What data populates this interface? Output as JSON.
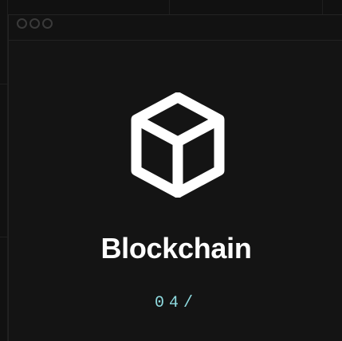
{
  "window": {
    "controls": [
      "window-dot",
      "window-dot",
      "window-dot"
    ]
  },
  "card": {
    "icon": "cube-icon",
    "title": "Blockchain",
    "index": "04/"
  },
  "colors": {
    "background": "#111111",
    "window": "#141414",
    "title": "#ffffff",
    "index": "#8fdbe0",
    "icon": "#ffffff"
  }
}
